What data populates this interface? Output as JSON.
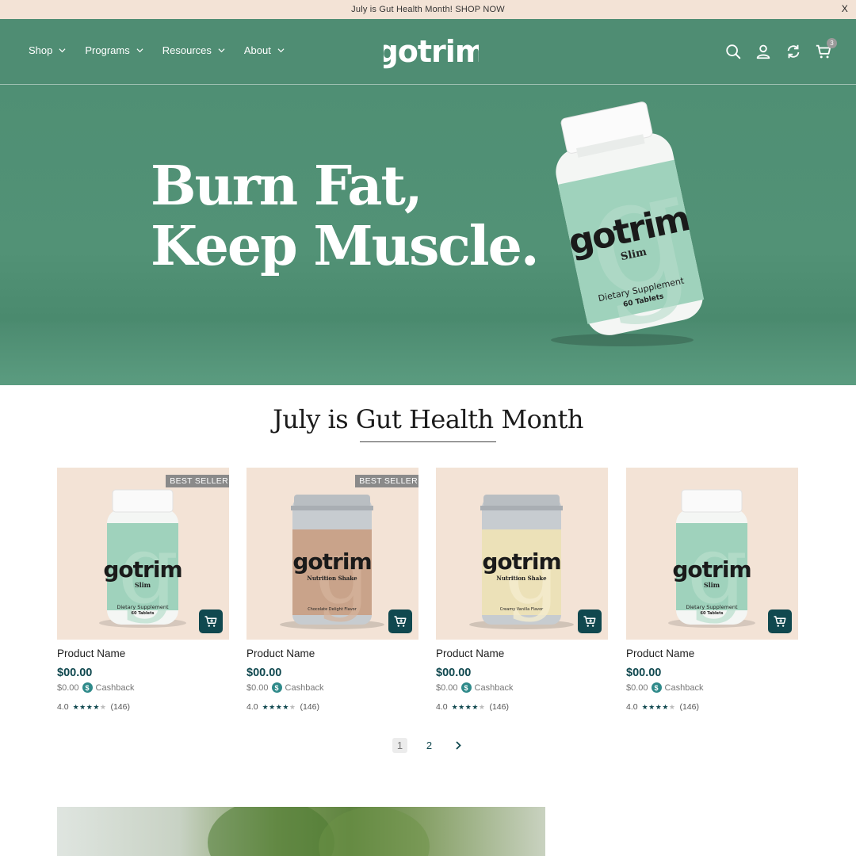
{
  "announcement": {
    "text": "July is Gut Health Month! SHOP NOW",
    "close": "X"
  },
  "header": {
    "nav": [
      {
        "label": "Shop"
      },
      {
        "label": "Programs"
      },
      {
        "label": "Resources"
      },
      {
        "label": "About"
      }
    ],
    "logo_text": "gotrim",
    "cart_count": "3"
  },
  "hero": {
    "line1": "Burn Fat,",
    "line2": "Keep Muscle.",
    "bottle": {
      "brand": "gotrim",
      "variant": "Slim",
      "label": "Dietary Supplement",
      "count": "60 Tablets"
    }
  },
  "section": {
    "title": "July is Gut Health Month"
  },
  "products": [
    {
      "badge": "BEST SELLER",
      "name": "Product Name",
      "price": "$00.00",
      "cashback_amount": "$0.00",
      "cashback_label": "Cashback",
      "rating": "4.0",
      "reviews": "(146)",
      "type": "bottle",
      "variant": "Slim",
      "label": "Dietary Supplement",
      "count": "60 Tablets"
    },
    {
      "badge": "BEST SELLER",
      "name": "Product Name",
      "price": "$00.00",
      "cashback_amount": "$0.00",
      "cashback_label": "Cashback",
      "rating": "4.0",
      "reviews": "(146)",
      "type": "tub",
      "variant": "Nutrition Shake",
      "flavor": "Chocolate Delight Flavor"
    },
    {
      "badge": "",
      "name": "Product Name",
      "price": "$00.00",
      "cashback_amount": "$0.00",
      "cashback_label": "Cashback",
      "rating": "4.0",
      "reviews": "(146)",
      "type": "tub",
      "variant": "Nutrition Shake",
      "flavor": "Creamy Vanilla Flavor"
    },
    {
      "badge": "",
      "name": "Product Name",
      "price": "$00.00",
      "cashback_amount": "$0.00",
      "cashback_label": "Cashback",
      "rating": "4.0",
      "reviews": "(146)",
      "type": "bottle",
      "variant": "Slim",
      "label": "Dietary Supplement",
      "count": "60 Tablets"
    }
  ],
  "pagination": {
    "pages": [
      "1",
      "2"
    ],
    "current": "1"
  },
  "colors": {
    "brand_green": "#4f8d73",
    "cream": "#f3e3d6",
    "dark_teal": "#10484f"
  },
  "icons": [
    "search-icon",
    "account-icon",
    "subscription-icon",
    "cart-icon",
    "chevron-down-icon",
    "add-to-cart-icon",
    "cashback-icon",
    "star-icon",
    "chevron-right-icon"
  ]
}
